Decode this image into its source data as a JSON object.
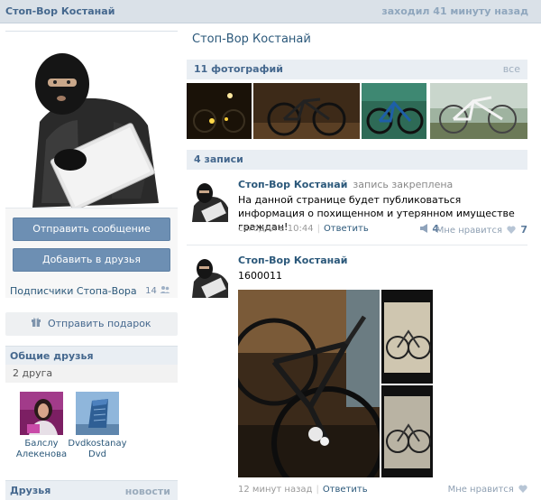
{
  "header": {
    "name": "Стоп-Вор Костанай",
    "last_seen": "заходил 41 минуту назад"
  },
  "left": {
    "buttons": {
      "send_message": "Отправить сообщение",
      "add_friend": "Добавить в друзья"
    },
    "subscribers": {
      "label": "Подписчики Стопа-Вора",
      "count": "14"
    },
    "gift": {
      "label": "Отправить подарок",
      "icon": "gift-icon"
    },
    "common_friends": {
      "title": "Общие друзья",
      "count_text": "2 друга",
      "people": [
        {
          "first": "Балслу",
          "last": "Алекенова"
        },
        {
          "first": "Dvdkostanay",
          "last": "Dvd"
        }
      ]
    },
    "friends": {
      "title": "Друзья",
      "action": "новости"
    }
  },
  "right": {
    "page_title": "Стоп-Вор Костанай",
    "photos": {
      "title": "11 фотографий",
      "all": "все"
    },
    "posts_title": "4 записи",
    "posts": [
      {
        "author": "Стоп-Вор Костанай",
        "pinned": "запись закреплена",
        "text": "На данной странице будет публиковаться информация о похищенном и утерянном имуществе граждан!",
        "time": "сегодня в 10:44",
        "reply": "Ответить",
        "shares": "4",
        "like_label": "Мне нравится",
        "likes": "7"
      },
      {
        "author": "Стоп-Вор Костанай",
        "text": "1600011",
        "time": "12 минут назад",
        "reply": "Ответить",
        "like_label": "Мне нравится"
      }
    ]
  }
}
